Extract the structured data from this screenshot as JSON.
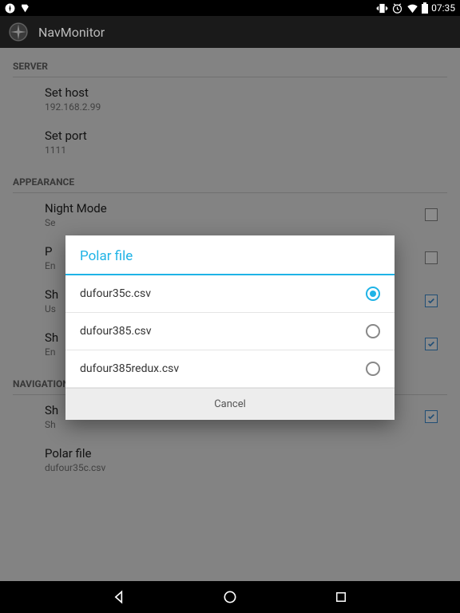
{
  "status": {
    "time": "07:35"
  },
  "app": {
    "title": "NavMonitor"
  },
  "sections": {
    "server": {
      "title": "SERVER",
      "host_label": "Set host",
      "host_value": "192.168.2.99",
      "port_label": "Set port",
      "port_value": "1111"
    },
    "appearance": {
      "title": "APPEARANCE",
      "night_label": "Night Mode",
      "night_sub": "Se",
      "p_label": "P",
      "p_sub": "En",
      "sh1_label": "Sh",
      "sh1_sub": "Us",
      "sh2_label": "Sh",
      "sh2_sub": "En"
    },
    "navigation": {
      "title": "NAVIGATION",
      "sh_label": "Sh",
      "sh_sub": "Sh",
      "polar_label": "Polar file",
      "polar_value": "dufour35c.csv"
    }
  },
  "dialog": {
    "title": "Polar file",
    "options": [
      "dufour35c.csv",
      "dufour385.csv",
      "dufour385redux.csv"
    ],
    "cancel": "Cancel"
  }
}
